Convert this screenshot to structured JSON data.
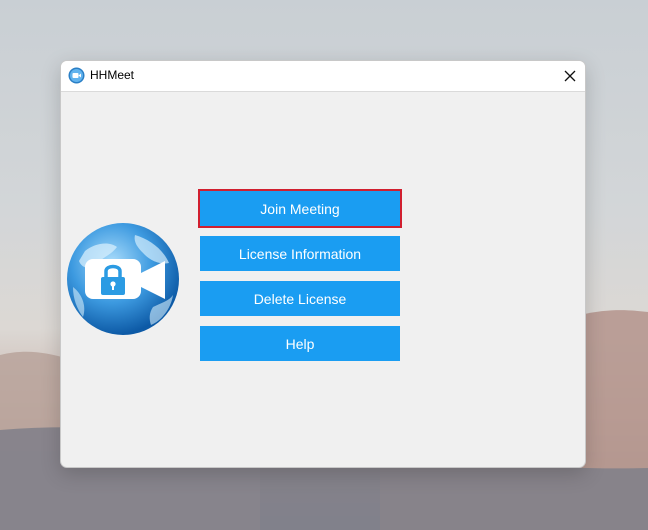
{
  "window": {
    "title": "HHMeet"
  },
  "icons": {
    "app": "hhmeet-app-icon",
    "close": "close-icon",
    "logo": "globe-video-lock-icon"
  },
  "buttons": [
    {
      "label": "Join Meeting",
      "focused": true
    },
    {
      "label": "License Information"
    },
    {
      "label": "Delete License"
    },
    {
      "label": "Help"
    }
  ],
  "colors": {
    "button": "#1a9df2",
    "focus_border": "#d11f2f",
    "window_bg": "#f0f0f0"
  }
}
